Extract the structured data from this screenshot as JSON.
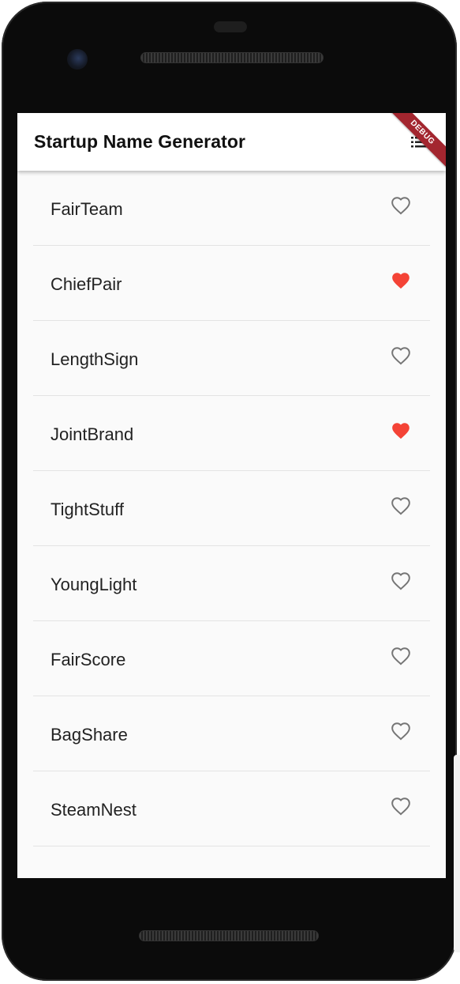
{
  "app_bar": {
    "title": "Startup Name Generator",
    "debug_banner": "DEBUG"
  },
  "colors": {
    "favorite": "#f44336",
    "not_favorite": "#757575",
    "background": "#fafafa",
    "debug_ribbon": "#a3262f"
  },
  "suggestions": [
    {
      "name": "FairTeam",
      "saved": false
    },
    {
      "name": "ChiefPair",
      "saved": true
    },
    {
      "name": "LengthSign",
      "saved": false
    },
    {
      "name": "JointBrand",
      "saved": true
    },
    {
      "name": "TightStuff",
      "saved": false
    },
    {
      "name": "YoungLight",
      "saved": false
    },
    {
      "name": "FairScore",
      "saved": false
    },
    {
      "name": "BagShare",
      "saved": false
    },
    {
      "name": "SteamNest",
      "saved": false
    }
  ]
}
